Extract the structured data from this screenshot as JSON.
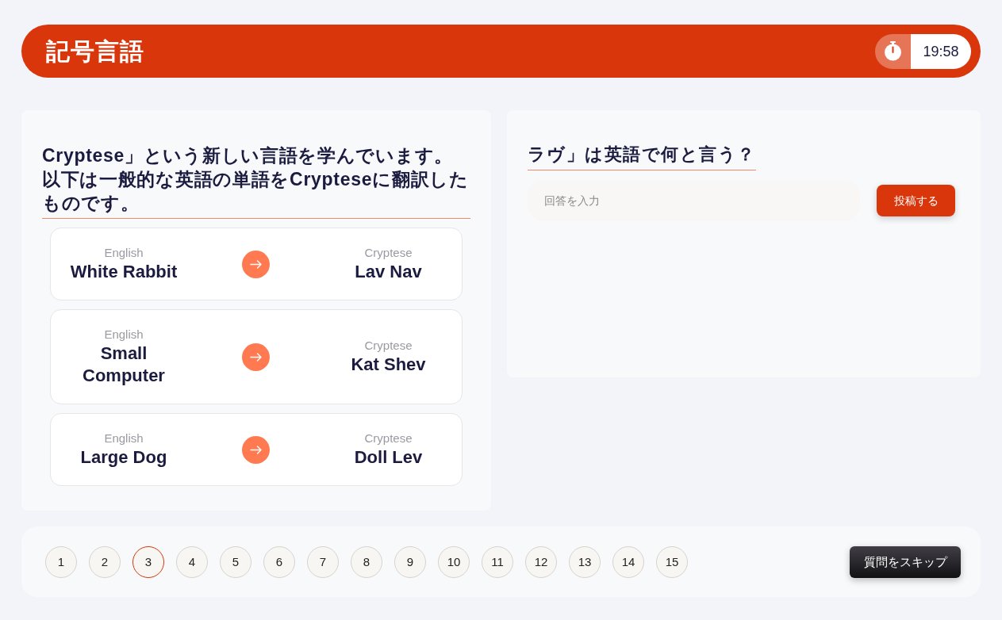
{
  "header": {
    "title": "記号言語",
    "timer": "19:58"
  },
  "intro": {
    "text": "Cryptese」という新しい言語を学んでいます。以下は一般的な英語の単語をCrypteseに翻訳したものです。",
    "pairs": [
      {
        "source_label": "English",
        "source": "White Rabbit",
        "target_label": "Cryptese",
        "target": "Lav Nav"
      },
      {
        "source_label": "English",
        "source": "Small Computer",
        "target_label": "Cryptese",
        "target": "Kat Shev"
      },
      {
        "source_label": "English",
        "source": "Large Dog",
        "target_label": "Cryptese",
        "target": "Doll Lev"
      }
    ]
  },
  "question": {
    "text": "ラヴ」は英語で何と言う？",
    "answer": {
      "placeholder": "回答を入力"
    },
    "submit": "投稿する"
  },
  "pagination": {
    "pages": [
      {
        "label": "1",
        "selected": false
      },
      {
        "label": "2",
        "selected": false
      },
      {
        "label": "3",
        "selected": true
      },
      {
        "label": "4",
        "selected": false
      },
      {
        "label": "5",
        "selected": false
      },
      {
        "label": "6",
        "selected": false
      },
      {
        "label": "7",
        "selected": false
      },
      {
        "label": "8",
        "selected": false
      },
      {
        "label": "9",
        "selected": false
      },
      {
        "label": "10",
        "selected": false
      },
      {
        "label": "11",
        "selected": false
      },
      {
        "label": "12",
        "selected": false
      },
      {
        "label": "13",
        "selected": false
      },
      {
        "label": "14",
        "selected": false
      },
      {
        "label": "15",
        "selected": false
      }
    ],
    "skip": "質問をスキップ"
  }
}
